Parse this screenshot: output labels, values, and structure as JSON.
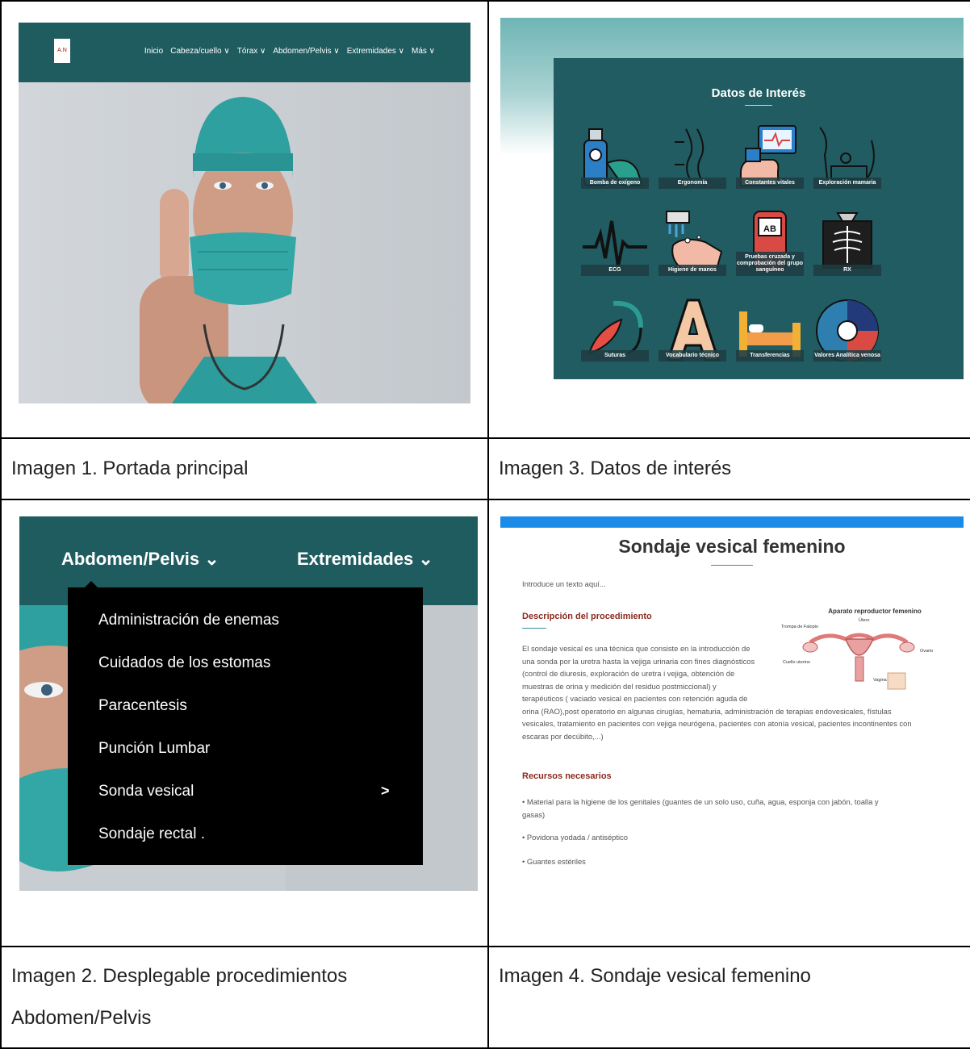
{
  "captions": {
    "img1": "Imagen 1. Portada principal",
    "img3": "Imagen 3. Datos de interés",
    "img2_line1": "Imagen 2. Desplegable procedimientos",
    "img2_line2": "Abdomen/Pelvis",
    "img4": "Imagen 4. Sondaje vesical femenino"
  },
  "image1": {
    "logo_text": "A.N",
    "nav": [
      "Inicio",
      "Cabeza/cuello ∨",
      "Tórax ∨",
      "Abdomen/Pelvis ∨",
      "Extremidades ∨",
      "Más ∨"
    ],
    "colors": {
      "nav_bg": "#1f5c60",
      "mask": "#2f9a9a"
    }
  },
  "image3": {
    "title": "Datos de Interés",
    "tiles": [
      "Bomba de oxígeno",
      "Ergonomía",
      "Constantes vitales",
      "Exploración mamaria",
      "ECG",
      "Higiene de manos",
      "Pruebas cruzada y comprobación del grupo sanguíneo",
      "RX",
      "Suturas",
      "Vocabulario técnico",
      "Transferencias",
      "Valores Analítica venosa"
    ],
    "blood_label": "AB",
    "colors": {
      "panel_bg": "#205c61"
    }
  },
  "image2": {
    "nav": [
      "Abdomen/Pelvis ⌄",
      "Extremidades ⌄"
    ],
    "dropdown": [
      "Administración de enemas",
      "Cuidados de los estomas",
      "Paracentesis",
      "Punción Lumbar",
      "Sonda vesical",
      "Sondaje rectal ."
    ],
    "submenu_chevron": ">"
  },
  "image4": {
    "title": "Sondaje vesical femenino",
    "intro": "Introduce un texto aquí...",
    "section1": "Descripción del procedimiento",
    "desc_lines": [
      "El sondaje vesical es una técnica que consiste en la introducción de",
      "una sonda por la uretra hasta la vejiga urinaria con fines diagnósticos",
      "(control de diuresis, exploración de uretra i vejiga, obtención de",
      "muestras de orina y medición del residuo postmiccional) y",
      "terapéuticos ( vaciado vesical en pacientes con retención aguda de",
      "orina (RAO),post operatorio en algunas cirugías, hematuria, administración de terapias endovesicales, fístulas",
      "vesicales, tratamiento en pacientes con vejiga neurógena, pacientes con atonía vesical, pacientes incontinentes con",
      "escaras por decúbito,...)"
    ],
    "section2": "Recursos necesarios",
    "resources": [
      "• Material para la higiene de los genitales (guantes de un solo uso, cuña, agua, esponja con jabón, toalla y",
      "gasas)",
      "• Povidona yodada / antiséptico",
      "• Guantes estériles"
    ],
    "figure": {
      "title": "Aparato reproductor femenino",
      "labels": [
        "Trompa de Falopio",
        "Útero",
        "Ovario",
        "Cuello uterino",
        "Vagina"
      ]
    }
  }
}
